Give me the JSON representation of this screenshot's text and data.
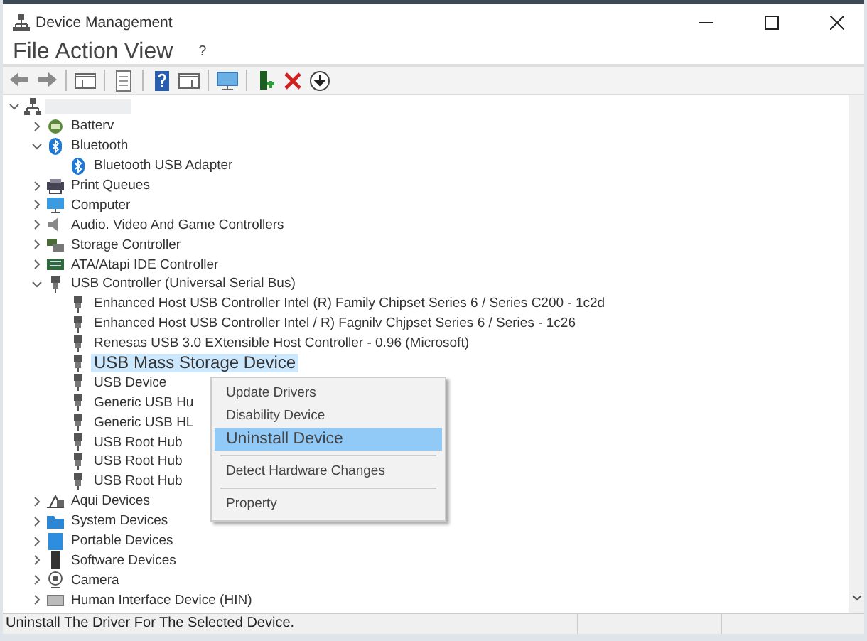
{
  "window": {
    "title": "Device Management"
  },
  "menu": [
    {
      "label": "File"
    },
    {
      "label": "Action"
    },
    {
      "label": "View"
    },
    {
      "label": "?"
    }
  ],
  "tree": [
    {
      "kind": "root",
      "expanded": true,
      "selected": false,
      "children": [
        {
          "label": "Batterv",
          "kind": "battery",
          "expanded": false,
          "selected": false
        },
        {
          "label": "Bluetooth",
          "kind": "bluetooth",
          "expanded": true,
          "selected": false,
          "children": [
            {
              "label": "Bluetooth USB Adapter",
              "kind": "bluetooth",
              "selected": false
            }
          ]
        },
        {
          "label": "Print Queues",
          "kind": "printer",
          "expanded": false,
          "selected": false
        },
        {
          "label": "Computer",
          "kind": "monitor",
          "expanded": false,
          "selected": false
        },
        {
          "label": "Audio. Video And Game Controllers",
          "kind": "speaker",
          "expanded": false,
          "selected": false
        },
        {
          "label": "Storage Controller",
          "kind": "storage",
          "expanded": false,
          "selected": false
        },
        {
          "label": "ATA/Atapi IDE Controller",
          "kind": "chip",
          "expanded": false,
          "selected": false
        },
        {
          "label": "USB Controller (Universal Serial Bus)",
          "kind": "usb",
          "expanded": true,
          "selected": false,
          "children": [
            {
              "label": "Enhanced Host USB Controller Intel (R) Family Chipset Series 6 / Series C200 - 1c2d",
              "kind": "usb",
              "selected": false
            },
            {
              "label": "Enhanced Host USB Controller Intel / R) Fagnilv Chjpset Series 6 / Series - 1c26",
              "kind": "usb",
              "selected": false
            },
            {
              "label": "Renesas USB 3.0 EXtensible Host Controller - 0.96 (Microsoft)",
              "kind": "usb",
              "selected": false
            },
            {
              "label": "USB Mass Storage Device",
              "kind": "usb",
              "selected": true
            },
            {
              "label": "USB Device",
              "kind": "usb",
              "selected": false
            },
            {
              "label": "Generic USB Hu",
              "kind": "usb",
              "selected": false
            },
            {
              "label": "Generic USB HL",
              "kind": "usb",
              "selected": false
            },
            {
              "label": "USB Root Hub",
              "kind": "usb",
              "selected": false
            },
            {
              "label": "USB Root Hub",
              "kind": "usb",
              "selected": false
            },
            {
              "label": "USB Root Hub",
              "kind": "usb",
              "selected": false
            }
          ]
        },
        {
          "label": "Aqui Devices",
          "kind": "network",
          "expanded": false,
          "selected": false
        },
        {
          "label": "System Devices",
          "kind": "folder",
          "expanded": false,
          "selected": false
        },
        {
          "label": "Portable Devices",
          "kind": "tablet",
          "expanded": false,
          "selected": false
        },
        {
          "label": "Software Devices",
          "kind": "phone",
          "expanded": false,
          "selected": false
        },
        {
          "label": "Camera",
          "kind": "webcam",
          "expanded": false,
          "selected": false
        },
        {
          "label": "Human Interface Device (HIN)",
          "kind": "keyboard",
          "expanded": false,
          "selected": false
        }
      ]
    }
  ],
  "context_menu": [
    {
      "kind": "item",
      "label": "Update Drivers",
      "selected": false
    },
    {
      "kind": "item",
      "label": "Disability Device",
      "selected": false
    },
    {
      "kind": "item",
      "label": "Uninstall Device",
      "selected": true
    },
    {
      "kind": "separator"
    },
    {
      "kind": "item",
      "label": "Detect Hardware Changes",
      "selected": false
    },
    {
      "kind": "separator"
    },
    {
      "kind": "item",
      "label": "Property",
      "selected": false
    }
  ],
  "status_bar": {
    "text": "Uninstall The Driver For The Selected Device."
  }
}
